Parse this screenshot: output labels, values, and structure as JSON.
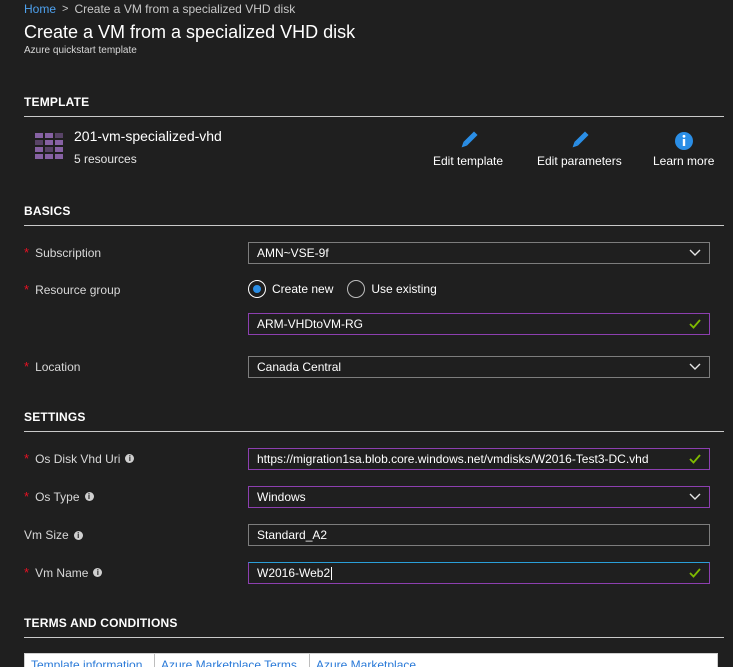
{
  "breadcrumb": {
    "home": "Home",
    "separator": ">",
    "current": "Create a VM from a specialized VHD disk"
  },
  "page": {
    "title": "Create a VM from a specialized VHD disk",
    "subtitle": "Azure quickstart template"
  },
  "template_section": {
    "heading": "TEMPLATE",
    "name": "201-vm-specialized-vhd",
    "resources": "5 resources",
    "icon": "template-grid-icon",
    "actions": {
      "edit_template": "Edit template",
      "edit_parameters": "Edit parameters",
      "learn_more": "Learn more"
    }
  },
  "basics": {
    "heading": "BASICS",
    "subscription_label": "Subscription",
    "subscription_value": "AMN~VSE-9f",
    "resource_group_label": "Resource group",
    "rg_create_new": "Create new",
    "rg_use_existing": "Use existing",
    "rg_selected": "Create new",
    "resource_group_value": "ARM-VHDtoVM-RG",
    "location_label": "Location",
    "location_value": "Canada Central"
  },
  "settings": {
    "heading": "SETTINGS",
    "os_disk_label": "Os Disk Vhd Uri",
    "os_disk_value": "https://migration1sa.blob.core.windows.net/vmdisks/W2016-Test3-DC.vhd",
    "os_type_label": "Os Type",
    "os_type_value": "Windows",
    "vm_size_label": "Vm Size",
    "vm_size_value": "Standard_A2",
    "vm_name_label": "Vm Name",
    "vm_name_value": "W2016-Web2"
  },
  "terms": {
    "heading": "TERMS AND CONDITIONS",
    "tabs": [
      "Template information",
      "Azure Marketplace Terms",
      "Azure Marketplace"
    ]
  },
  "colors": {
    "background": "#1f1f1f",
    "link": "#4ea1ee",
    "required": "#e81123",
    "accent_border": "#8c3fb0",
    "valid_check": "#7fba00",
    "icon_blue": "#2a8ee6",
    "template_icon": "#8661a3"
  }
}
